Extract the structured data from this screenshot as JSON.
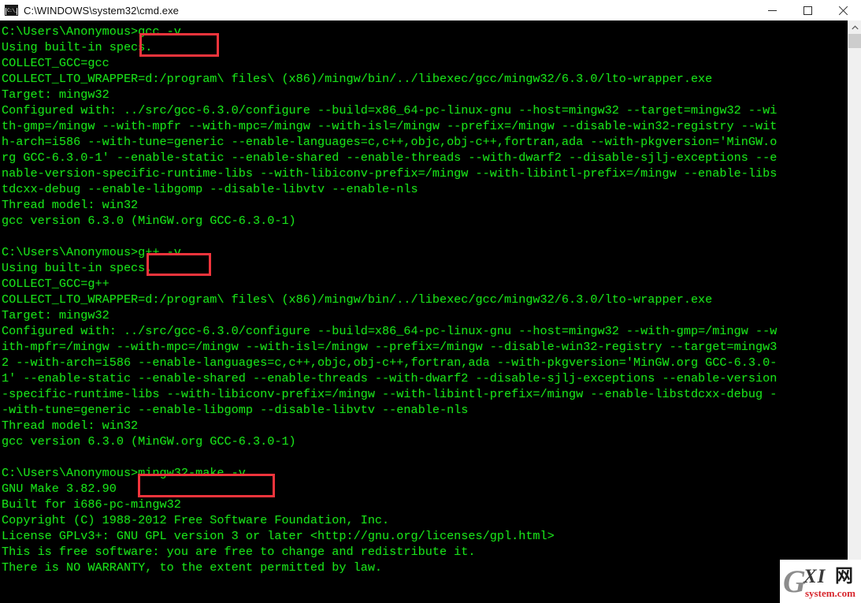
{
  "window": {
    "title": "C:\\WINDOWS\\system32\\cmd.exe",
    "icon": "cmd-icon",
    "icon_glyph": "C:\\_",
    "controls": {
      "minimize_label": "Minimize",
      "maximize_label": "Maximize",
      "close_label": "Close"
    },
    "background_color": "#000000",
    "text_color": "#19e019",
    "titlebar_color": "#ffffff"
  },
  "scrollbar": {
    "up_arrow": "˄",
    "down_arrow": "˅",
    "thumb_position_pct": 2
  },
  "annotations": {
    "color": "#f2343c",
    "boxes": [
      {
        "label": "gcc -v",
        "id": "highlight-gcc-command"
      },
      {
        "label": "g++ -v",
        "id": "highlight-gpp-command"
      },
      {
        "label": "mingw32-make -v",
        "id": "highlight-make-command"
      }
    ]
  },
  "watermark": {
    "g": "G",
    "xi": "XI",
    "cjk": "网",
    "domain": "system.com"
  },
  "console": {
    "prompt": "C:\\Users\\Anonymous>",
    "lines": [
      "C:\\Users\\Anonymous>gcc -v",
      "Using built-in specs.",
      "COLLECT_GCC=gcc",
      "COLLECT_LTO_WRAPPER=d:/program\\ files\\ (x86)/mingw/bin/../libexec/gcc/mingw32/6.3.0/lto-wrapper.exe",
      "Target: mingw32",
      "Configured with: ../src/gcc-6.3.0/configure --build=x86_64-pc-linux-gnu --host=mingw32 --target=mingw32 --wi",
      "th-gmp=/mingw --with-mpfr --with-mpc=/mingw --with-isl=/mingw --prefix=/mingw --disable-win32-registry --wit",
      "h-arch=i586 --with-tune=generic --enable-languages=c,c++,objc,obj-c++,fortran,ada --with-pkgversion='MinGW.o",
      "rg GCC-6.3.0-1' --enable-static --enable-shared --enable-threads --with-dwarf2 --disable-sjlj-exceptions --e",
      "nable-version-specific-runtime-libs --with-libiconv-prefix=/mingw --with-libintl-prefix=/mingw --enable-libs",
      "tdcxx-debug --enable-libgomp --disable-libvtv --enable-nls",
      "Thread model: win32",
      "gcc version 6.3.0 (MinGW.org GCC-6.3.0-1)",
      "",
      "C:\\Users\\Anonymous>g++ -v",
      "Using built-in specs.",
      "COLLECT_GCC=g++",
      "COLLECT_LTO_WRAPPER=d:/program\\ files\\ (x86)/mingw/bin/../libexec/gcc/mingw32/6.3.0/lto-wrapper.exe",
      "Target: mingw32",
      "Configured with: ../src/gcc-6.3.0/configure --build=x86_64-pc-linux-gnu --host=mingw32 --with-gmp=/mingw --w",
      "ith-mpfr=/mingw --with-mpc=/mingw --with-isl=/mingw --prefix=/mingw --disable-win32-registry --target=mingw3",
      "2 --with-arch=i586 --enable-languages=c,c++,objc,obj-c++,fortran,ada --with-pkgversion='MinGW.org GCC-6.3.0-",
      "1' --enable-static --enable-shared --enable-threads --with-dwarf2 --disable-sjlj-exceptions --enable-version",
      "-specific-runtime-libs --with-libiconv-prefix=/mingw --with-libintl-prefix=/mingw --enable-libstdcxx-debug -",
      "-with-tune=generic --enable-libgomp --disable-libvtv --enable-nls",
      "Thread model: win32",
      "gcc version 6.3.0 (MinGW.org GCC-6.3.0-1)",
      "",
      "C:\\Users\\Anonymous>mingw32-make -v",
      "GNU Make 3.82.90",
      "Built for i686-pc-mingw32",
      "Copyright (C) 1988-2012 Free Software Foundation, Inc.",
      "License GPLv3+: GNU GPL version 3 or later <http://gnu.org/licenses/gpl.html>",
      "This is free software: you are free to change and redistribute it.",
      "There is NO WARRANTY, to the extent permitted by law."
    ]
  }
}
